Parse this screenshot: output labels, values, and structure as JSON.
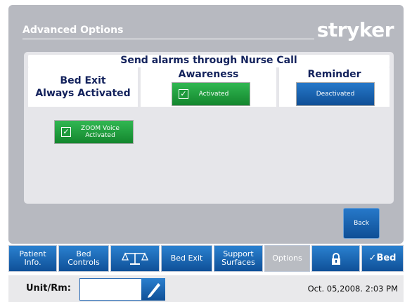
{
  "header": {
    "title": "Advanced Options",
    "brand": "stryker"
  },
  "panel": {
    "title": "Send alarms through Nurse Call",
    "bed_exit": {
      "line1": "Bed Exit",
      "line2": "Always Activated"
    },
    "awareness": {
      "title": "Awareness",
      "button_label": "Activated",
      "checked": true
    },
    "reminder": {
      "title": "Reminder",
      "button_label": "Deactivated",
      "checked": false
    },
    "zoom_voice": {
      "line1": "ZOOM Voice",
      "line2": "Activated",
      "checked": true
    }
  },
  "back_button": {
    "label": "Back"
  },
  "tabs": [
    {
      "label1": "Patient",
      "label2": "Info."
    },
    {
      "label1": "Bed",
      "label2": "Controls"
    },
    {
      "label1": "",
      "label2": "",
      "icon": "scale-icon"
    },
    {
      "label1": "Bed Exit",
      "label2": ""
    },
    {
      "label1": "Support",
      "label2": "Surfaces"
    },
    {
      "label1": "Options",
      "label2": "",
      "active": true
    },
    {
      "label1": "",
      "label2": "",
      "icon": "lock-icon"
    },
    {
      "label1": "Bed",
      "label2": "",
      "icon": "bed-check-icon"
    }
  ],
  "footer": {
    "unit_label": "Unit/Rm:",
    "unit_value": "",
    "datetime": "Oct. 05,2008. 2:03 PM"
  },
  "colors": {
    "accent_blue": "#0f5098",
    "activated_green": "#13862d",
    "title_navy": "#13225c",
    "screen_gray": "#b7b9c0"
  }
}
